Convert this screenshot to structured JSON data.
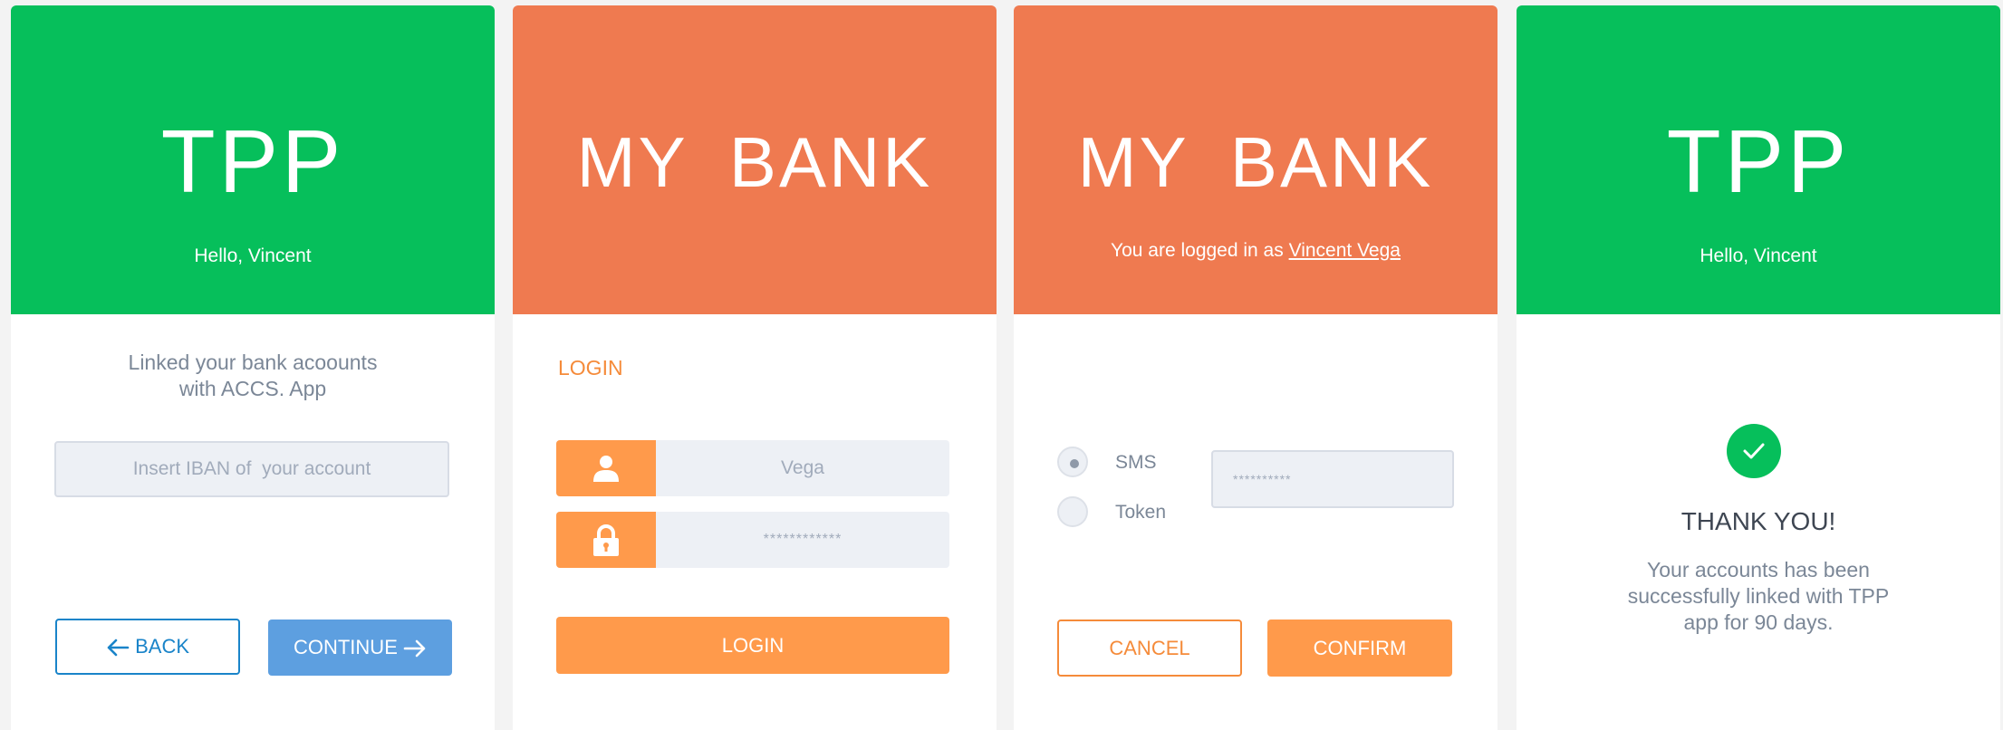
{
  "colors": {
    "tpp_green": "#06bf5b",
    "bank_orange": "#ef7a50",
    "button_orange": "#ff9a4b",
    "link_blue": "#1a84c9",
    "continue_blue": "#5d9fe0"
  },
  "panel_1": {
    "brand": "TPP",
    "greeting": "Hello, Vincent",
    "intro_line_1": "Linked your bank acoounts",
    "intro_line_2": "with ACCS. App",
    "iban_placeholder": "Insert IBAN of  your account",
    "back_label": "BACK",
    "back_icon": "arrow-left-icon",
    "continue_label": "CONTINUE",
    "continue_icon": "arrow-right-icon"
  },
  "panel_2": {
    "brand": "MY BANK",
    "login_title": "LOGIN",
    "username_icon": "user-icon",
    "username_value": "Vega",
    "password_icon": "lock-icon",
    "password_value": "************",
    "login_button": "LOGIN"
  },
  "panel_3": {
    "brand": "MY BANK",
    "logged_in_prefix": "You are logged in as",
    "logged_in_user": "Vincent Vega",
    "options": [
      {
        "label": "SMS",
        "selected": true
      },
      {
        "label": "Token",
        "selected": false
      }
    ],
    "otp_value": "**********",
    "cancel_label": "CANCEL",
    "confirm_label": "CONFIRM"
  },
  "panel_4": {
    "brand": "TPP",
    "greeting": "Hello, Vincent",
    "check_icon": "checkmark-icon",
    "thank_you": "THANK YOU!",
    "message_line_1": "Your accounts has been",
    "message_line_2": "successfully linked with TPP",
    "message_line_3": "app for 90 days."
  }
}
